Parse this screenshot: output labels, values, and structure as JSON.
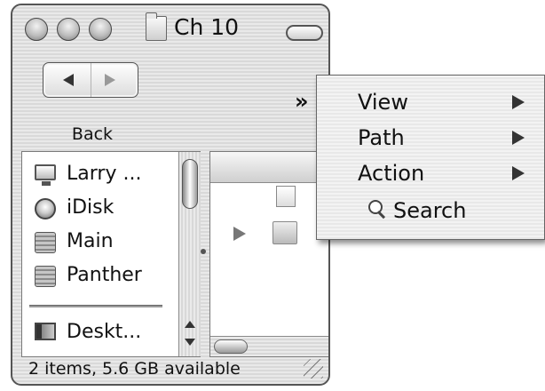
{
  "window": {
    "title": "Ch 10"
  },
  "toolbar": {
    "back_label": "Back",
    "overflow_label": "»"
  },
  "sidebar": {
    "items": [
      {
        "label": "Larry ...",
        "icon": "computer-icon"
      },
      {
        "label": "iDisk",
        "icon": "idisk-icon"
      },
      {
        "label": "Main",
        "icon": "hard-disk-icon"
      },
      {
        "label": "Panther",
        "icon": "hard-disk-icon"
      },
      {
        "label": "Deskt...",
        "icon": "desktop-icon"
      }
    ]
  },
  "status": {
    "text": "2 items, 5.6 GB available"
  },
  "menu": {
    "items": [
      {
        "label": "View",
        "submenu": true
      },
      {
        "label": "Path",
        "submenu": true
      },
      {
        "label": "Action",
        "submenu": true
      },
      {
        "label": "Search",
        "submenu": false,
        "icon": "search-icon"
      }
    ]
  }
}
